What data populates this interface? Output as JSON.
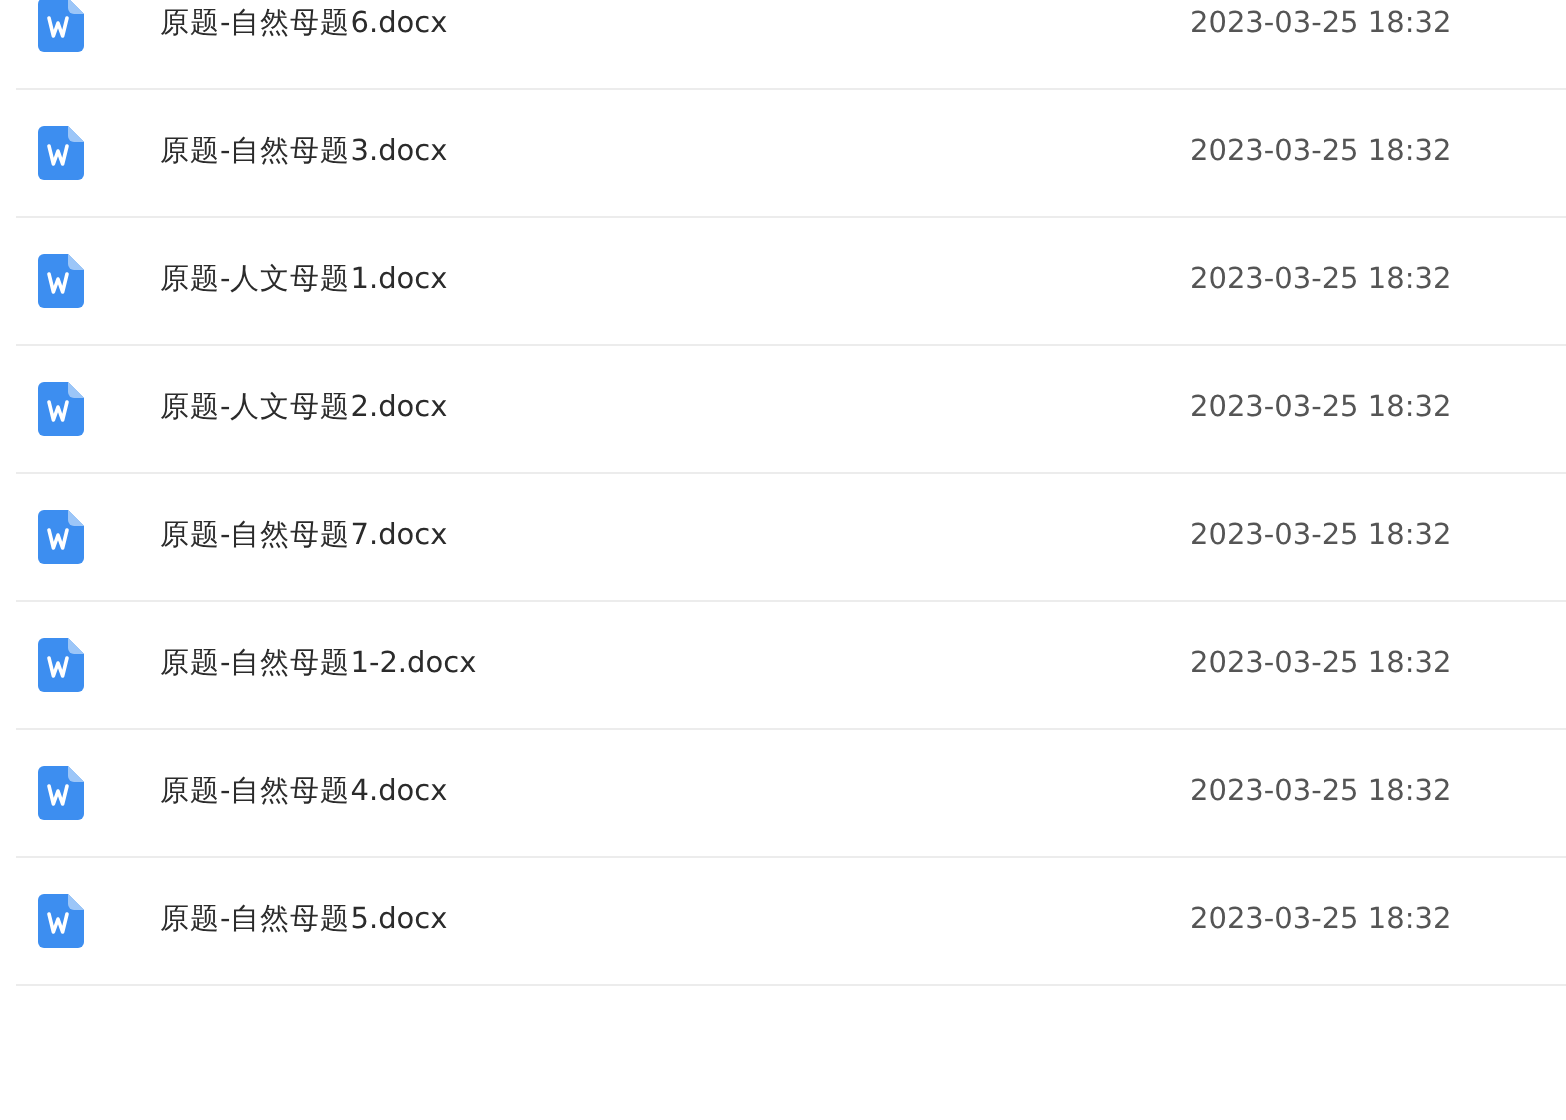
{
  "files": [
    {
      "name": "原题-自然母题6.docx",
      "modified": "2023-03-25 18:32"
    },
    {
      "name": "原题-自然母题3.docx",
      "modified": "2023-03-25 18:32"
    },
    {
      "name": "原题-人文母题1.docx",
      "modified": "2023-03-25 18:32"
    },
    {
      "name": "原题-人文母题2.docx",
      "modified": "2023-03-25 18:32"
    },
    {
      "name": "原题-自然母题7.docx",
      "modified": "2023-03-25 18:32"
    },
    {
      "name": "原题-自然母题1-2.docx",
      "modified": "2023-03-25 18:32"
    },
    {
      "name": "原题-自然母题4.docx",
      "modified": "2023-03-25 18:32"
    },
    {
      "name": "原题-自然母题5.docx",
      "modified": "2023-03-25 18:32"
    }
  ]
}
